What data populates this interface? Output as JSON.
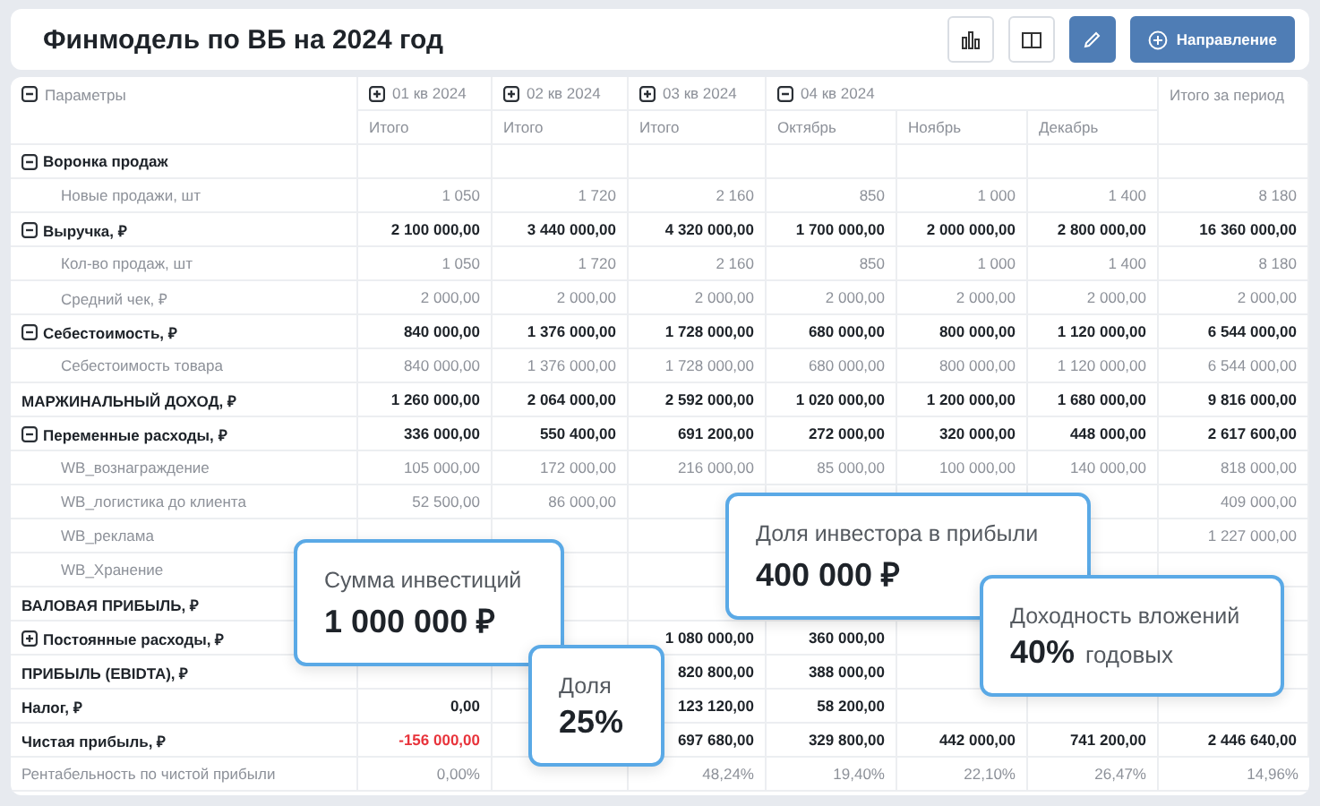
{
  "header": {
    "title": "Финмодель по ВБ на 2024 год",
    "toolbar": [
      {
        "kind": "outline"
      },
      {
        "kind": "outline"
      },
      {
        "kind": "primary"
      },
      {
        "kind": "primary",
        "label": "Направление"
      }
    ]
  },
  "table": {
    "columns": {
      "parameters": {
        "label": "Параметры",
        "expanded": true
      },
      "periods": [
        {
          "label": "01 кв 2024",
          "expanded": false,
          "subcolumns": [
            "Итого"
          ]
        },
        {
          "label": "02 кв 2024",
          "expanded": false,
          "subcolumns": [
            "Итого"
          ]
        },
        {
          "label": "03 кв 2024",
          "expanded": false,
          "subcolumns": [
            "Итого"
          ]
        },
        {
          "label": "04 кв 2024",
          "expanded": true,
          "subcolumns": [
            "Октябрь",
            "Ноябрь",
            "Декабрь"
          ]
        }
      ],
      "total": "Итого за период"
    },
    "rows": [
      {
        "label": "Воронка продаж",
        "kind": "group",
        "expanded": true,
        "children": [
          {
            "label": "Новые продажи, шт",
            "kind": "item",
            "cells": {
              "column_1": "1 050",
              "column_2": "1 720",
              "column_3": "2 160",
              "column_4": "850",
              "column_5": "1 000",
              "column_6": "1 400",
              "column_7": "8 180"
            }
          }
        ]
      },
      {
        "label": "Выручка, ₽",
        "kind": "group",
        "expanded": true,
        "cells": {
          "column_1": "2 100 000,00",
          "column_2": "3 440 000,00",
          "column_3": "4 320 000,00",
          "column_4": "1 700 000,00",
          "column_5": "2 000 000,00",
          "column_6": "2 800 000,00",
          "column_7": "16 360 000,00"
        },
        "children": [
          {
            "label": "Кол-во продаж, шт",
            "kind": "item",
            "cells": {
              "column_1": "1 050",
              "column_2": "1 720",
              "column_3": "2 160",
              "column_4": "850",
              "column_5": "1 000",
              "column_6": "1 400",
              "column_7": "8 180"
            }
          },
          {
            "label": "Средний чек, ₽",
            "kind": "item",
            "cells": {
              "column_1": "2 000,00",
              "column_2": "2 000,00",
              "column_3": "2 000,00",
              "column_4": "2 000,00",
              "column_5": "2 000,00",
              "column_6": "2 000,00",
              "column_7": "2 000,00"
            }
          }
        ]
      },
      {
        "label": "Себестоимость, ₽",
        "kind": "group",
        "expanded": true,
        "cells": {
          "column_1": "840 000,00",
          "column_2": "1 376 000,00",
          "column_3": "1 728 000,00",
          "column_4": "680 000,00",
          "column_5": "800 000,00",
          "column_6": "1 120 000,00",
          "column_7": "6 544 000,00"
        },
        "children": [
          {
            "label": "Себестоимость товара",
            "kind": "item",
            "cells": {
              "column_1": "840 000,00",
              "column_2": "1 376 000,00",
              "column_3": "1 728 000,00",
              "column_4": "680 000,00",
              "column_5": "800 000,00",
              "column_6": "1 120 000,00",
              "column_7": "6 544 000,00"
            }
          }
        ]
      },
      {
        "label": "МАРЖИНАЛЬНЫЙ ДОХОД, ₽",
        "kind": "total",
        "cells": {
          "column_1": "1 260 000,00",
          "column_2": "2 064 000,00",
          "column_3": "2 592 000,00",
          "column_4": "1 020 000,00",
          "column_5": "1 200 000,00",
          "column_6": "1 680 000,00",
          "column_7": "9 816 000,00"
        }
      },
      {
        "label": "Переменные расходы, ₽",
        "kind": "group",
        "expanded": true,
        "cells": {
          "column_1": "336 000,00",
          "column_2": "550 400,00",
          "column_3": "691 200,00",
          "column_4": "272 000,00",
          "column_5": "320 000,00",
          "column_6": "448 000,00",
          "column_7": "2 617 600,00"
        },
        "children": [
          {
            "label": "WB_вознаграждение",
            "kind": "item",
            "cells": {
              "column_1": "105 000,00",
              "column_2": "172 000,00",
              "column_3": "216 000,00",
              "column_4": "85 000,00",
              "column_5": "100 000,00",
              "column_6": "140 000,00",
              "column_7": "818 000,00"
            }
          },
          {
            "label": "WB_логистика до клиента",
            "kind": "item",
            "cells": {
              "column_1": "52 500,00",
              "column_2": "86 000,00",
              "column_7": "409 000,00"
            }
          },
          {
            "label": "WB_реклама",
            "kind": "item",
            "cells": {
              "column_7": "1 227 000,00"
            }
          },
          {
            "label": "WB_Хранение",
            "kind": "item"
          }
        ]
      },
      {
        "label": "ВАЛОВАЯ ПРИБЫЛЬ, ₽",
        "kind": "total"
      },
      {
        "label": "Постоянные расходы, ₽",
        "kind": "group",
        "expanded": false,
        "cells": {
          "column_3": "1 080 000,00",
          "column_4": "360 000,00"
        }
      },
      {
        "label": "ПРИБЫЛЬ (EBIDTA), ₽",
        "kind": "total",
        "cells": {
          "column_3": "820 800,00",
          "column_4": "388 000,00"
        }
      },
      {
        "label": "Налог, ₽",
        "kind": "total",
        "cells": {
          "column_1": "0,00",
          "column_3": "123 120,00",
          "column_4": "58 200,00"
        }
      },
      {
        "label": "Чистая прибыль, ₽",
        "kind": "total",
        "cells": {
          "column_1": {
            "text": "-156 000,00",
            "negative": true
          },
          "column_3": "697 680,00",
          "column_4": "329 800,00",
          "column_5": "442 000,00",
          "column_6": "741 200,00",
          "column_7": "2 446 640,00"
        }
      },
      {
        "label": "Рентабельность по чистой прибыли",
        "kind": "item",
        "cells": {
          "column_1": "0,00%",
          "column_3": "48,24%",
          "column_4": "19,40%",
          "column_5": "22,10%",
          "column_6": "26,47%",
          "column_7": "14,96%"
        }
      }
    ]
  },
  "callouts": [
    {
      "label": "Сумма инвестиций",
      "value": "1 000 000 ₽"
    },
    {
      "label": "Доля",
      "value": "25%"
    },
    {
      "label": "Доля инвестора в прибыли",
      "value": "400 000 ₽"
    },
    {
      "label": "Доходность вложений",
      "value": "40%",
      "suffix": "годовых"
    }
  ]
}
